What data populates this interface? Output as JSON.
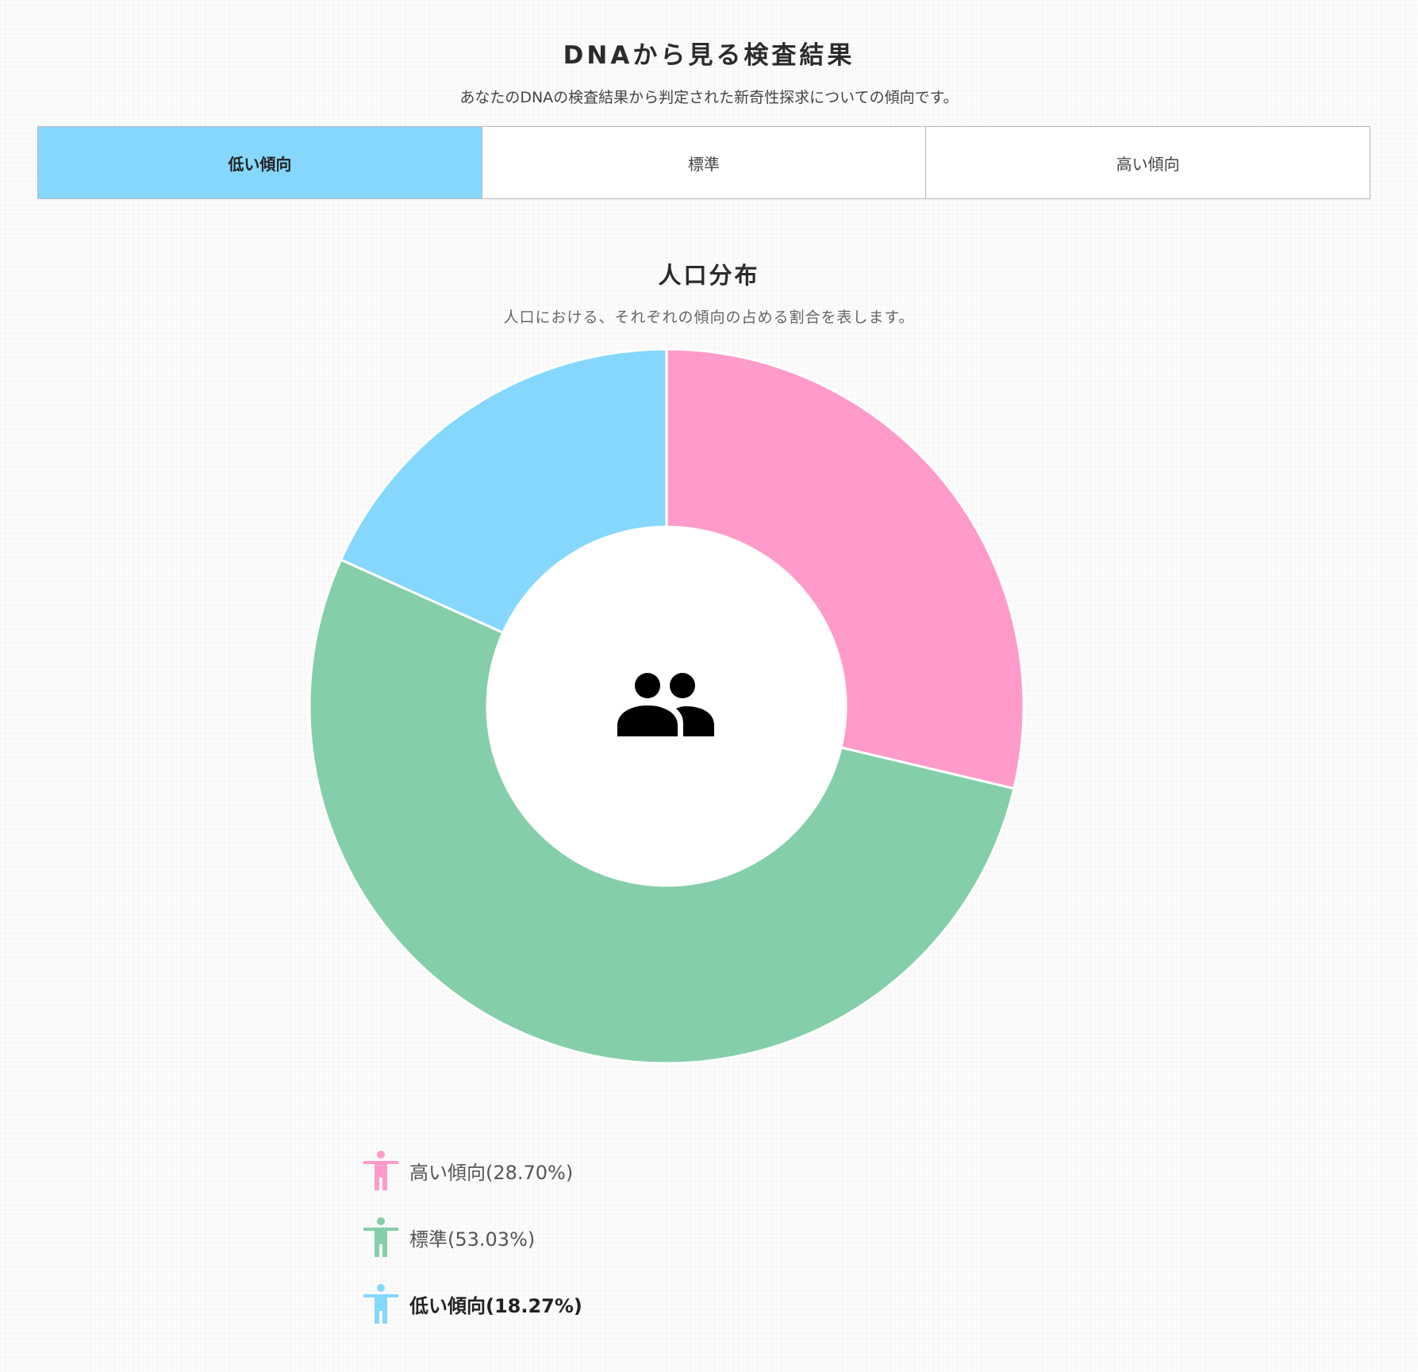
{
  "header": {
    "title": "DNAから見る検査結果",
    "subtitle": "あなたのDNAの検査結果から判定された新奇性探求についての傾向です。"
  },
  "tabs": [
    {
      "label": "低い傾向",
      "active": true
    },
    {
      "label": "標準",
      "active": false
    },
    {
      "label": "高い傾向",
      "active": false
    }
  ],
  "section": {
    "title": "人口分布",
    "subtitle": "人口における、それぞれの傾向の占める割合を表します。"
  },
  "center_icon": "people-icon",
  "colors": {
    "high": "#ff9bca",
    "standard": "#84cfa9",
    "low": "#86d7fd"
  },
  "chart_data": {
    "type": "pie",
    "donut": true,
    "start": "top",
    "direction": "clockwise",
    "slices": [
      {
        "label": "高い傾向",
        "value": 28.7,
        "color": "#ff9bca"
      },
      {
        "label": "標準",
        "value": 53.03,
        "color": "#84cfa9"
      },
      {
        "label": "低い傾向",
        "value": 18.27,
        "color": "#86d7fd"
      }
    ]
  },
  "legend": [
    {
      "text": "高い傾向(28.70%)",
      "color": "#ff9bca",
      "icon": "person-icon",
      "active": false
    },
    {
      "text": "標準(53.03%)",
      "color": "#84cfa9",
      "icon": "person-icon",
      "active": false
    },
    {
      "text": "低い傾向(18.27%)",
      "color": "#86d7fd",
      "icon": "person-icon",
      "active": true
    }
  ]
}
